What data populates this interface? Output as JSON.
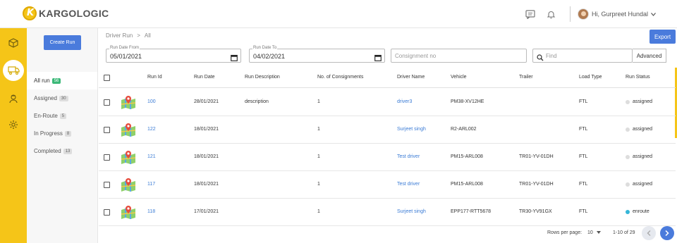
{
  "app": {
    "logo_text": "KARGOLOGIC"
  },
  "topbar": {
    "greeting": "Hi, Gurpreet Hundal"
  },
  "sidebar": {
    "create_label": "Create Run",
    "items": [
      {
        "label": "All run",
        "count": "56"
      },
      {
        "label": "Assigned",
        "count": "30"
      },
      {
        "label": "En-Route",
        "count": "5"
      },
      {
        "label": "In Progress",
        "count": "8"
      },
      {
        "label": "Completed",
        "count": "13"
      }
    ]
  },
  "breadcrumb": {
    "root": "Driver Run",
    "sep": ">",
    "current": "All"
  },
  "export_label": "Export",
  "filters": {
    "from_label": "Run Date From",
    "from_value": "05/01/2021",
    "to_label": "Run Date To",
    "to_value": "04/02/2021",
    "consignment_placeholder": "Consignment no",
    "find_placeholder": "Find",
    "advanced_label": "Advanced"
  },
  "table": {
    "headers": [
      "Run Id",
      "Run Date",
      "Run Description",
      "No. of Consignments",
      "Driver Name",
      "Vehicle",
      "Trailer",
      "Load Type",
      "Run Status"
    ],
    "rows": [
      {
        "id": "100",
        "date": "28/01/2021",
        "desc": "description",
        "cons": "1",
        "driver": "driver3",
        "vehicle": "PM38-XV12HE",
        "trailer": "",
        "load": "FTL",
        "status": "assigned"
      },
      {
        "id": "122",
        "date": "18/01/2021",
        "desc": "",
        "cons": "1",
        "driver": "Surjeet singh",
        "vehicle": "R2-ARL002",
        "trailer": "",
        "load": "FTL",
        "status": "assigned"
      },
      {
        "id": "121",
        "date": "18/01/2021",
        "desc": "",
        "cons": "1",
        "driver": "Test driver",
        "vehicle": "PM15-ARL008",
        "trailer": "TR01-YV-01DH",
        "load": "FTL",
        "status": "assigned"
      },
      {
        "id": "117",
        "date": "18/01/2021",
        "desc": "",
        "cons": "1",
        "driver": "Test driver",
        "vehicle": "PM15-ARL008",
        "trailer": "TR01-YV-01DH",
        "load": "FTL",
        "status": "assigned"
      },
      {
        "id": "118",
        "date": "17/01/2021",
        "desc": "",
        "cons": "1",
        "driver": "Surjeet singh",
        "vehicle": "EPP177-RTT5678",
        "trailer": "TR30-YV91GX",
        "load": "FTL",
        "status": "enroute"
      }
    ]
  },
  "pagination": {
    "rows_label": "Rows per page:",
    "rows_value": "10",
    "range": "1-10 of 29"
  },
  "colors": {
    "accent": "#4a7bdc",
    "rail": "#f5c518",
    "link": "#3a7bd5",
    "enroute": "#35b6d8"
  }
}
